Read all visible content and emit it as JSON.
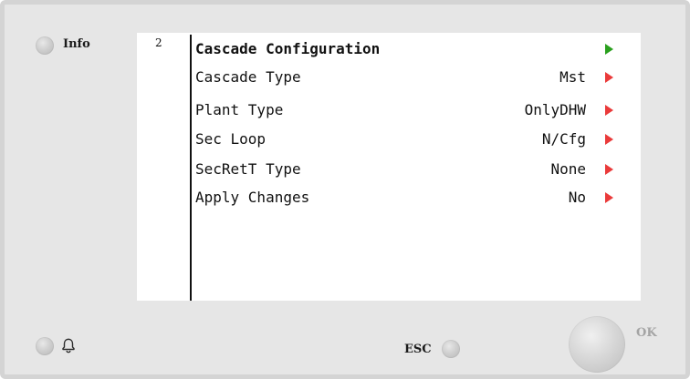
{
  "panel": {
    "info_label": "Info",
    "esc_label": "ESC",
    "ok_label": "OK"
  },
  "screen": {
    "page_number": "2",
    "title": "Cascade Configuration",
    "rows": [
      {
        "label": "Cascade Type",
        "value": "Mst"
      },
      {
        "label": "Plant Type",
        "value": "OnlyDHW"
      },
      {
        "label": "Sec Loop",
        "value": "N/Cfg"
      },
      {
        "label": "SecRetT Type",
        "value": "None"
      },
      {
        "label": "Apply Changes",
        "value": "No"
      }
    ]
  },
  "colors": {
    "screen_bg": "#ffffff",
    "panel_bg": "#e6e6e6",
    "header_arrow": "#2aa01e",
    "row_arrow": "#ea3a3a"
  },
  "icons": {
    "info_led": "led-circle",
    "alarm": "bell-icon",
    "esc_led": "led-circle",
    "ok": "round-button"
  }
}
